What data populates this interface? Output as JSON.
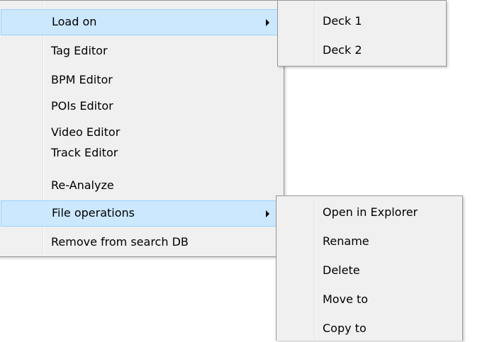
{
  "main_menu": {
    "items": [
      {
        "label": "Load on",
        "has_submenu": true,
        "highlighted": true
      },
      {
        "label": "Tag Editor"
      },
      {
        "label": "BPM Editor"
      },
      {
        "label": "POIs Editor"
      },
      {
        "label": "Video Editor"
      },
      {
        "label": "Track Editor"
      },
      {
        "label": "Re-Analyze"
      },
      {
        "label": "File operations",
        "has_submenu": true,
        "highlighted": true
      },
      {
        "label": "Remove from search DB"
      }
    ]
  },
  "load_on_submenu": {
    "items": [
      {
        "label": "Deck 1"
      },
      {
        "label": "Deck 2"
      }
    ]
  },
  "file_operations_submenu": {
    "items": [
      {
        "label": "Open in Explorer"
      },
      {
        "label": "Rename"
      },
      {
        "label": "Delete"
      },
      {
        "label": "Move to"
      },
      {
        "label": "Copy to"
      }
    ]
  },
  "colors": {
    "menu_background": "#f0f0f0",
    "highlight_fill": "#cce8ff",
    "highlight_border": "#99d1ff",
    "menu_border": "#979797"
  },
  "icons": {
    "submenu_arrow": "chevron-right-icon"
  }
}
